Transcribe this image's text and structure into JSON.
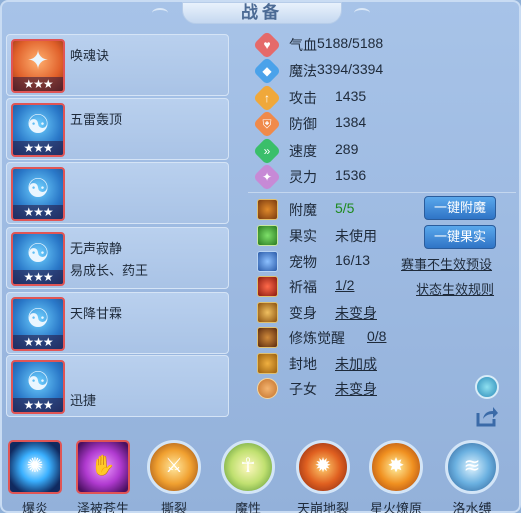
{
  "title": "战备",
  "skill_slots": [
    {
      "name": "唤魂诀",
      "sub": "",
      "stars": "★★★",
      "glyph": "✦"
    },
    {
      "name": "五雷轰顶",
      "sub": "",
      "stars": "★★★",
      "glyph": "☯"
    },
    {
      "name": "",
      "sub": "",
      "stars": "★★★",
      "glyph": "☯"
    },
    {
      "name": "无声寂静",
      "sub": "易成长、药王",
      "stars": "★★★",
      "glyph": "☯"
    },
    {
      "name": "天降甘霖",
      "sub": "",
      "stars": "★★★",
      "glyph": "☯"
    },
    {
      "name": "",
      "sub": "迅捷",
      "stars": "★★★",
      "glyph": "☯"
    }
  ],
  "stats": [
    {
      "label": "气血",
      "value": "5188/5188",
      "color": "#e56a6a",
      "icon": "heart-icon",
      "glyph": "♥"
    },
    {
      "label": "魔法",
      "value": "3394/3394",
      "color": "#4aa2ea",
      "icon": "mana-icon",
      "glyph": "◆"
    },
    {
      "label": "攻击",
      "value": "1435",
      "color": "#f0a83a",
      "icon": "attack-icon",
      "glyph": "↑"
    },
    {
      "label": "防御",
      "value": "1384",
      "color": "#f08a4a",
      "icon": "defense-icon",
      "glyph": "⛨"
    },
    {
      "label": "速度",
      "value": "289",
      "color": "#3abf6a",
      "icon": "speed-icon",
      "glyph": "»"
    },
    {
      "label": "灵力",
      "value": "1536",
      "color": "#c78ad6",
      "icon": "spirit-icon",
      "glyph": "✦"
    }
  ],
  "rows": {
    "enchant": {
      "label": "附魔",
      "value": "5/5"
    },
    "fruit": {
      "label": "果实",
      "value": "未使用"
    },
    "pet": {
      "label": "宠物",
      "value": "16/13"
    },
    "blessing": {
      "label": "祈福",
      "value": "1/2"
    },
    "transform": {
      "label": "变身",
      "value": "未变身"
    },
    "cultivation": {
      "label": "修炼觉醒",
      "value": "0/8"
    },
    "fief": {
      "label": "封地",
      "value": "未加成"
    },
    "children": {
      "label": "子女",
      "value": "未变身"
    }
  },
  "buttons": {
    "enchant": "一键附魔",
    "fruit": "一键果实"
  },
  "links": {
    "preset": "赛事不生效预设",
    "rules": "状态生效规则"
  },
  "bottom_skills": [
    {
      "label": "爆炎",
      "glyph": "✺",
      "square": true
    },
    {
      "label": "泽被苍生",
      "glyph": "✋",
      "square": true
    },
    {
      "label": "撕裂",
      "glyph": "⚔",
      "square": false
    },
    {
      "label": "魔性",
      "glyph": "☥",
      "square": false
    },
    {
      "label": "天崩地裂",
      "glyph": "✹",
      "square": false
    },
    {
      "label": "星火燎原",
      "glyph": "✸",
      "square": false
    },
    {
      "label": "洛水缚",
      "glyph": "≋",
      "square": false
    }
  ]
}
